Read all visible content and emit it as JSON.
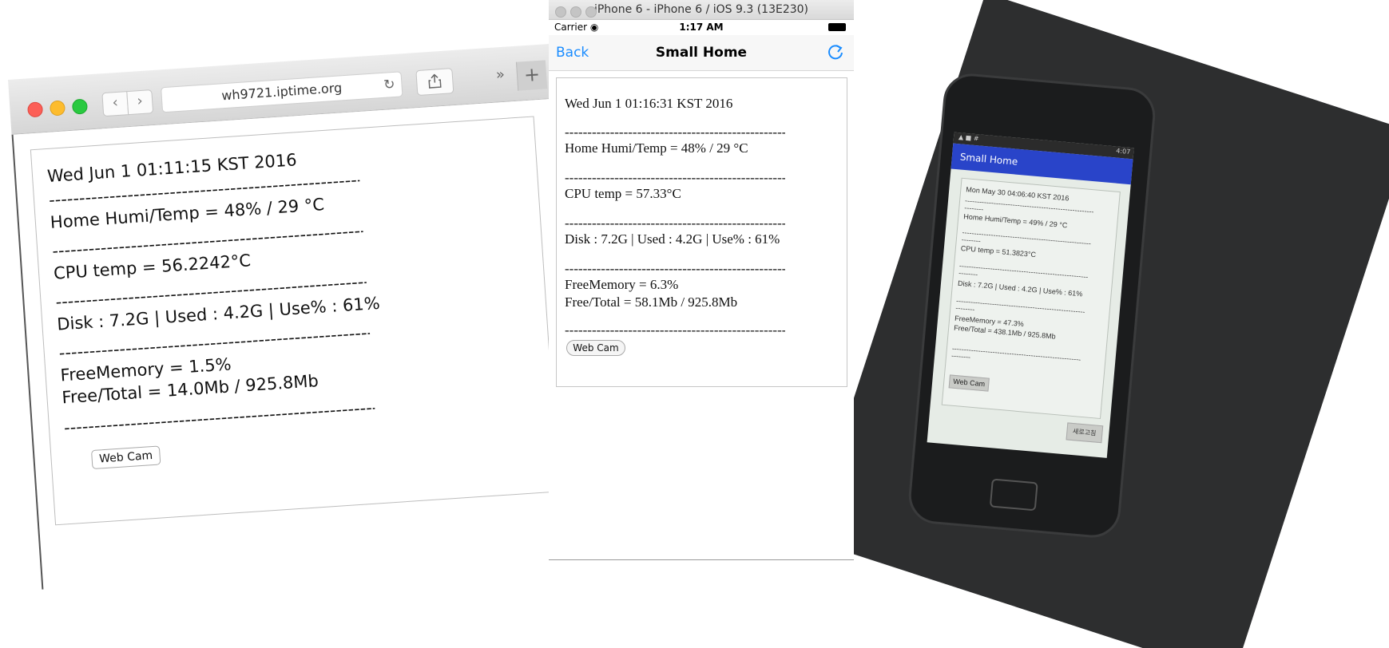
{
  "safari": {
    "url": "wh9721.iptime.org",
    "date": "Wed Jun 1 01:11:15 KST 2016",
    "separator": "------------------------------------------------------",
    "humi_temp": "Home Humi/Temp = 48% / 29 °C",
    "cpu_temp": "CPU temp = 56.2242°C",
    "disk": "Disk : 7.2G | Used : 4.2G | Use% : 61%",
    "free_memory": "FreeMemory = 1.5%",
    "free_total": "Free/Total = 14.0Mb / 925.8Mb",
    "webcam_label": "Web Cam"
  },
  "iphone": {
    "simulator_title": "iPhone 6 - iPhone 6 / iOS 9.3 (13E230)",
    "carrier": "Carrier",
    "time": "1:17 AM",
    "back_label": "Back",
    "nav_title": "Small Home",
    "date": "Wed Jun 1 01:16:31 KST 2016",
    "separator": "------------------------------------------------------",
    "humi_temp": "Home Humi/Temp = 48% / 29 °C",
    "cpu_temp": "CPU temp = 57.33°C",
    "disk": "Disk : 7.2G | Used : 4.2G | Use% : 61%",
    "free_memory": "FreeMemory = 6.3%",
    "free_total": "Free/Total = 58.1Mb / 925.8Mb",
    "webcam_label": "Web Cam"
  },
  "android": {
    "clock": "4:07",
    "app_title": "Small Home",
    "date": "Mon May 30 04:06:40 KST 2016",
    "separator": "------------------------------------------------------",
    "separator_tail": "--------",
    "humi_temp": "Home Humi/Temp = 49% / 29 °C",
    "cpu_temp": "CPU temp = 51.3823°C",
    "disk": "Disk : 7.2G | Used : 4.2G | Use% : 61%",
    "free_memory": "FreeMemory = 47.3%",
    "free_total": "Free/Total = 438.1Mb / 925.8Mb",
    "webcam_label": "Web Cam",
    "refresh_label": "새로고침"
  },
  "colors": {
    "ios_accent": "#1a8cff",
    "android_appbar": "#2944c9"
  }
}
